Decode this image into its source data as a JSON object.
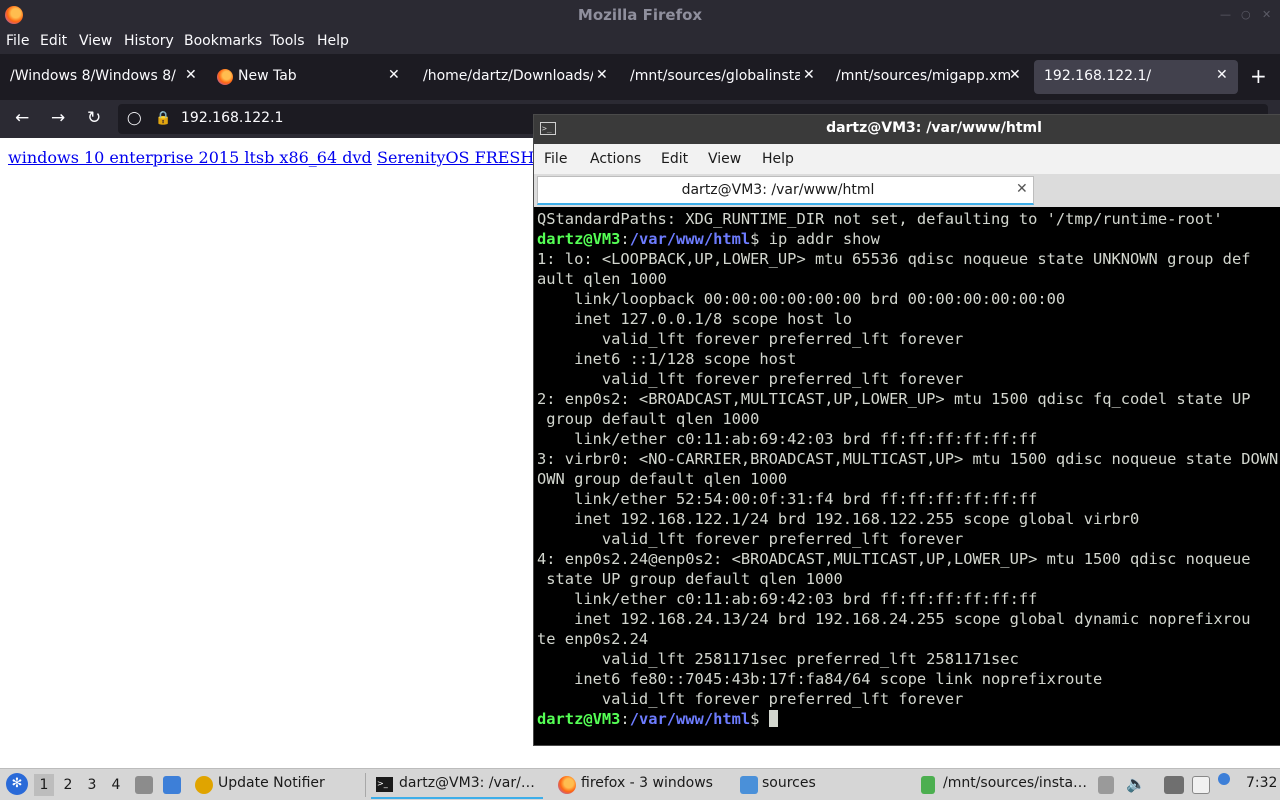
{
  "firefox": {
    "window_title": "Mozilla Firefox",
    "menu": [
      "File",
      "Edit",
      "View",
      "History",
      "Bookmarks",
      "Tools",
      "Help"
    ],
    "tabs": [
      {
        "label": "/Windows 8/Windows 8/ | "
      },
      {
        "label": "New Tab"
      },
      {
        "label": "/home/dartz/Downloads/[…"
      },
      {
        "label": "/mnt/sources/globalinstall"
      },
      {
        "label": "/mnt/sources/migapp.xml"
      },
      {
        "label": "192.168.122.1/"
      }
    ],
    "url": "192.168.122.1",
    "page_links": [
      "windows 10 enterprise 2015 ltsb x86_64 dvd",
      "SerenityOS FRESH"
    ]
  },
  "terminal": {
    "title": "dartz@VM3: /var/www/html",
    "menu": [
      "File",
      "Actions",
      "Edit",
      "View",
      "Help"
    ],
    "tab_label": "dartz@VM3: /var/www/html",
    "prompt_user": "dartz@VM3",
    "prompt_path": "/var/www/html",
    "command": " ip addr show",
    "lines": [
      "QStandardPaths: XDG_RUNTIME_DIR not set, defaulting to '/tmp/runtime-root'",
      "",
      "1: lo: <LOOPBACK,UP,LOWER_UP> mtu 65536 qdisc noqueue state UNKNOWN group def",
      "ault qlen 1000",
      "    link/loopback 00:00:00:00:00:00 brd 00:00:00:00:00:00",
      "    inet 127.0.0.1/8 scope host lo",
      "       valid_lft forever preferred_lft forever",
      "    inet6 ::1/128 scope host",
      "       valid_lft forever preferred_lft forever",
      "2: enp0s2: <BROADCAST,MULTICAST,UP,LOWER_UP> mtu 1500 qdisc fq_codel state UP",
      " group default qlen 1000",
      "    link/ether c0:11:ab:69:42:03 brd ff:ff:ff:ff:ff:ff",
      "3: virbr0: <NO-CARRIER,BROADCAST,MULTICAST,UP> mtu 1500 qdisc noqueue state DOWN",
      "OWN group default qlen 1000",
      "    link/ether 52:54:00:0f:31:f4 brd ff:ff:ff:ff:ff:ff",
      "    inet 192.168.122.1/24 brd 192.168.122.255 scope global virbr0",
      "       valid_lft forever preferred_lft forever",
      "4: enp0s2.24@enp0s2: <BROADCAST,MULTICAST,UP,LOWER_UP> mtu 1500 qdisc noqueue",
      " state UP group default qlen 1000",
      "    link/ether c0:11:ab:69:42:03 brd ff:ff:ff:ff:ff:ff",
      "    inet 192.168.24.13/24 brd 192.168.24.255 scope global dynamic noprefixrou",
      "te enp0s2.24",
      "       valid_lft 2581171sec preferred_lft 2581171sec",
      "    inet6 fe80::7045:43b:17f:fa84/64 scope link noprefixroute",
      "       valid_lft forever preferred_lft forever"
    ]
  },
  "taskbar": {
    "workspaces": [
      "1",
      "2",
      "3",
      "4"
    ],
    "items": [
      {
        "label": "Update Notifier"
      },
      {
        "label": "dartz@VM3: /var/…"
      },
      {
        "label": "firefox - 3 windows"
      },
      {
        "label": "sources"
      },
      {
        "label": "/mnt/sources/insta…"
      }
    ],
    "clock": "7:32"
  },
  "colors": {
    "accent": "#3daee9",
    "prompt_user": "#55ff55",
    "prompt_path": "#6d7cff",
    "link": "#0000ee"
  }
}
